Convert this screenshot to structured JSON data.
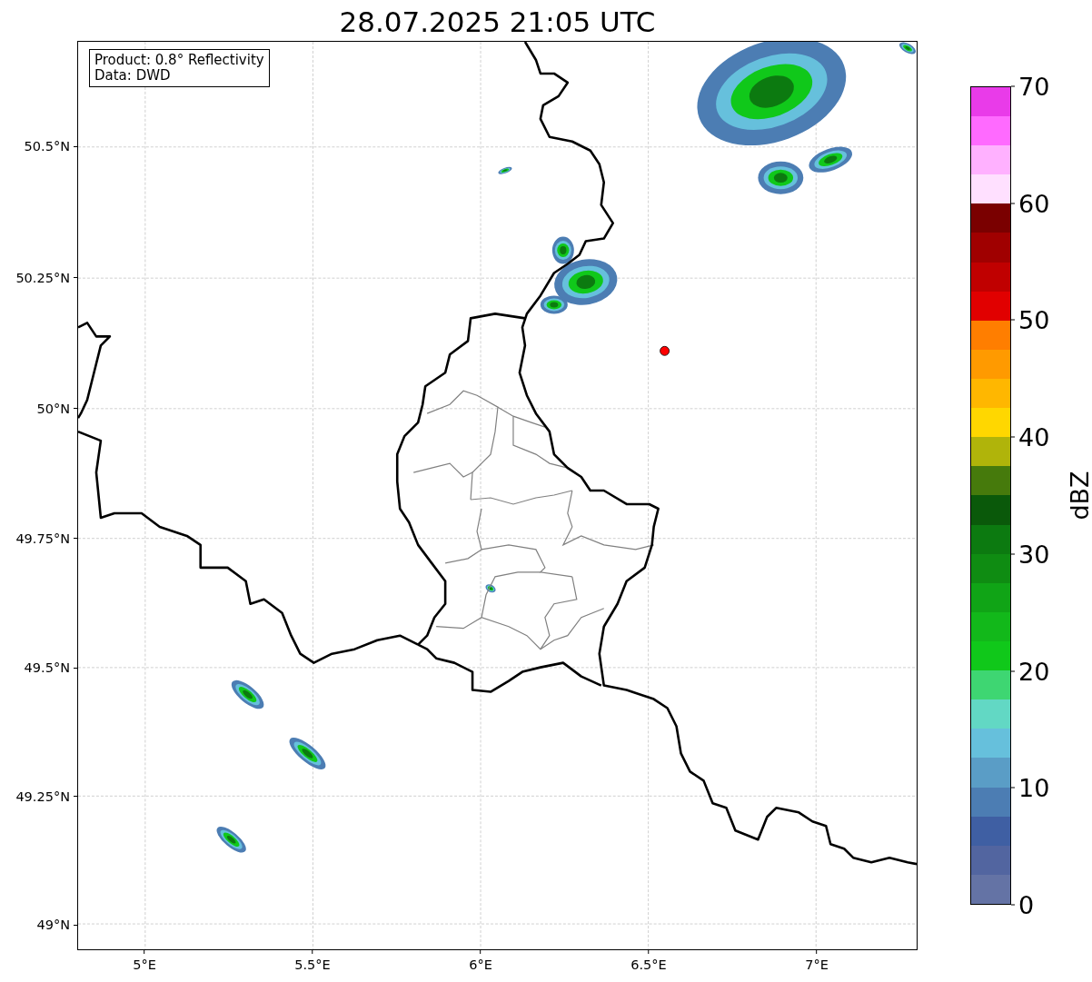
{
  "title": "28.07.2025 21:05 UTC",
  "legend": [
    "Product: 0.8° Reflectivity",
    "Data: DWD"
  ],
  "x_ticks": [
    "5°E",
    "5.5°E",
    "6°E",
    "6.5°E",
    "7°E"
  ],
  "y_ticks": [
    "50.5°N",
    "50.25°N",
    "50°N",
    "49.75°N",
    "49.5°N",
    "49.25°N",
    "49°N"
  ],
  "colorbar": {
    "label": "dBZ",
    "ticks": [
      "70",
      "60",
      "50",
      "40",
      "30",
      "20",
      "10",
      "0"
    ]
  }
}
